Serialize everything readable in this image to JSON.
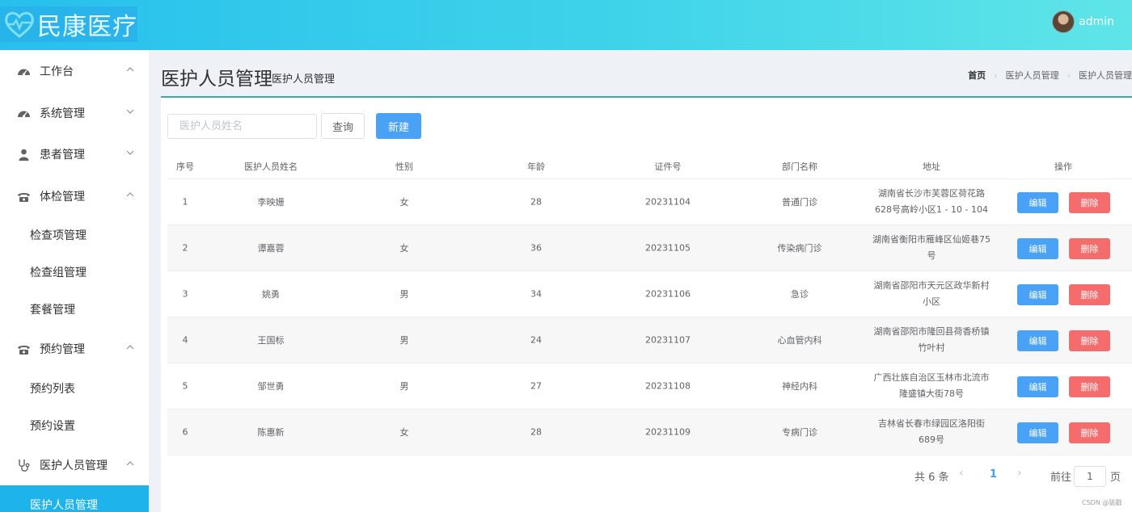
{
  "header": {
    "logo_text": "民康医疗",
    "user_name": "admin"
  },
  "sidebar": {
    "items": [
      {
        "label": "工作台",
        "type": "parent",
        "icon": "dashboard-icon",
        "arrow": "up"
      },
      {
        "label": "系统管理",
        "type": "parent",
        "icon": "dashboard-icon",
        "arrow": "down"
      },
      {
        "label": "患者管理",
        "type": "parent",
        "icon": "user-icon",
        "arrow": "down"
      },
      {
        "label": "体检管理",
        "type": "parent",
        "icon": "phone-icon",
        "arrow": "up"
      },
      {
        "label": "检查项管理",
        "type": "child"
      },
      {
        "label": "检查组管理",
        "type": "child"
      },
      {
        "label": "套餐管理",
        "type": "child"
      },
      {
        "label": "预约管理",
        "type": "parent",
        "icon": "phone-icon",
        "arrow": "up"
      },
      {
        "label": "预约列表",
        "type": "child"
      },
      {
        "label": "预约设置",
        "type": "child"
      },
      {
        "label": "医护人员管理",
        "type": "parent",
        "icon": "stethoscope-icon",
        "arrow": "up"
      },
      {
        "label": "医护人员管理",
        "type": "child",
        "active": true
      }
    ]
  },
  "page": {
    "title": "医护人员管理",
    "subtitle": "医护人员管理",
    "breadcrumb": [
      "首页",
      "医护人员管理",
      "医护人员管理"
    ]
  },
  "toolbar": {
    "search_placeholder": "医护人员姓名",
    "query_label": "查询",
    "new_label": "新建"
  },
  "table": {
    "headers": [
      "序号",
      "医护人员姓名",
      "性别",
      "年龄",
      "证件号",
      "部门名称",
      "地址",
      "操作"
    ],
    "rows": [
      {
        "index": "1",
        "name": "李映姗",
        "gender": "女",
        "age": "28",
        "id_no": "20231104",
        "dept": "普通门诊",
        "address": "湖南省长沙市芙蓉区荷花路628号高岭小区1 - 10 - 104"
      },
      {
        "index": "2",
        "name": "谭嘉蓉",
        "gender": "女",
        "age": "36",
        "id_no": "20231105",
        "dept": "传染病门诊",
        "address": "湖南省衡阳市雁峰区仙姬巷75号"
      },
      {
        "index": "3",
        "name": "姚勇",
        "gender": "男",
        "age": "34",
        "id_no": "20231106",
        "dept": "急诊",
        "address": "湖南省邵阳市天元区政华新村小区"
      },
      {
        "index": "4",
        "name": "王国标",
        "gender": "男",
        "age": "24",
        "id_no": "20231107",
        "dept": "心血管内科",
        "address": "湖南省邵阳市隆回县荷香桥镇竹叶村"
      },
      {
        "index": "5",
        "name": "邹世勇",
        "gender": "男",
        "age": "27",
        "id_no": "20231108",
        "dept": "神经内科",
        "address": "广西壮族自治区玉林市北流市隆盛镇大街78号"
      },
      {
        "index": "6",
        "name": "陈惠新",
        "gender": "女",
        "age": "28",
        "id_no": "20231109",
        "dept": "专病门诊",
        "address": "吉林省长春市绿园区洛阳街689号"
      }
    ],
    "edit_label": "编辑",
    "delete_label": "删除"
  },
  "pagination": {
    "total_text": "共 6 条",
    "current_page": "1",
    "goto_label": "前往",
    "goto_value": "1",
    "page_unit": "页"
  },
  "watermark": "CSDN @猛戳",
  "colors": {
    "header_gradient_start": "#27c0ec",
    "header_gradient_end": "#5fe5e8",
    "primary": "#4aa2f7",
    "danger": "#f56c6c",
    "sidebar_active": "#1fb3ec"
  }
}
